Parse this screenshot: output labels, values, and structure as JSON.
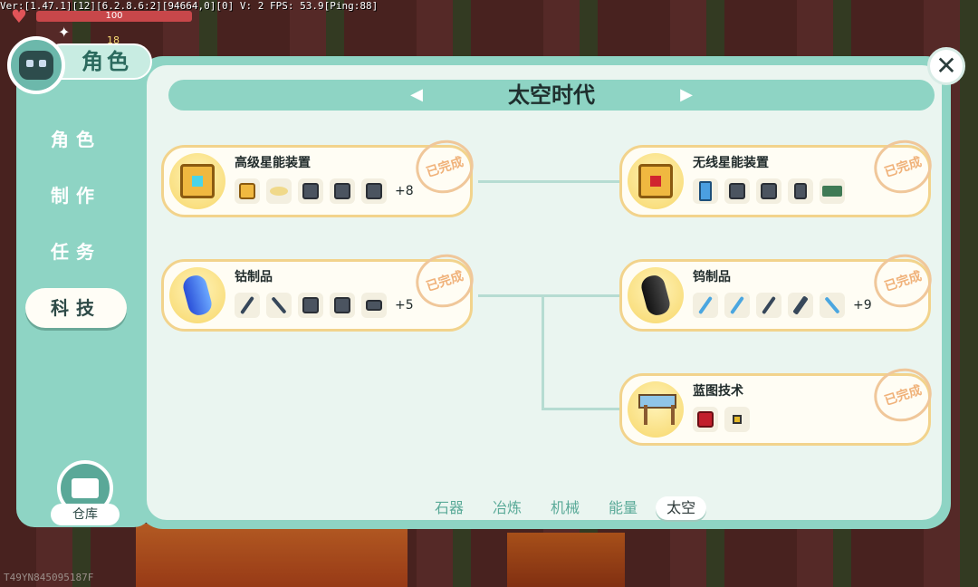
{
  "debug": "Ver:[1.47.1][12][6.2.8.6:2][94664,0][0] V: 2 FPS: 53.9[Ping:88]",
  "hp": "100",
  "level": "18",
  "device_id": "T49YN845095187F",
  "sidebar": {
    "title": "角色",
    "items": [
      {
        "label": "角色",
        "active": false
      },
      {
        "label": "制作",
        "active": false
      },
      {
        "label": "任务",
        "active": false
      },
      {
        "label": "科技",
        "active": true
      }
    ],
    "warehouse": "仓库"
  },
  "era": {
    "title": "太空时代",
    "prev_icon": "arrow-left-icon",
    "next_icon": "arrow-right-icon"
  },
  "close_icon": "close-icon",
  "cards": [
    {
      "name": "高级星能装置",
      "status": "已完成",
      "more": "+8"
    },
    {
      "name": "无线星能装置",
      "status": "已完成",
      "more": ""
    },
    {
      "name": "钴制品",
      "status": "已完成",
      "more": "+5"
    },
    {
      "name": "钨制品",
      "status": "已完成",
      "more": "+9"
    },
    {
      "name": "蓝图技术",
      "status": "已完成",
      "more": ""
    }
  ],
  "tabs": [
    {
      "label": "石器",
      "active": false
    },
    {
      "label": "冶炼",
      "active": false
    },
    {
      "label": "机械",
      "active": false
    },
    {
      "label": "能量",
      "active": false
    },
    {
      "label": "太空",
      "active": true
    }
  ]
}
